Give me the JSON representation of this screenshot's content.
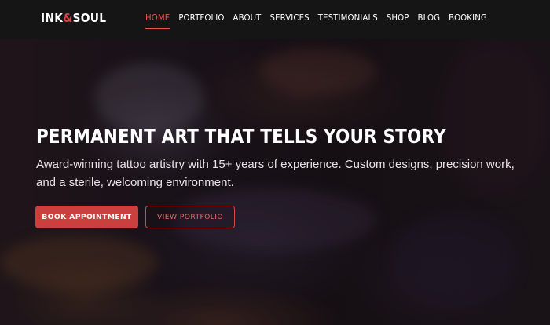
{
  "brand": {
    "name_part1": "INK",
    "ampersand": "&",
    "name_part2": "SOUL"
  },
  "nav": {
    "items": [
      {
        "label": "HOME",
        "active": true
      },
      {
        "label": "PORTFOLIO",
        "active": false
      },
      {
        "label": "ABOUT",
        "active": false
      },
      {
        "label": "SERVICES",
        "active": false
      },
      {
        "label": "TESTIMONIALS",
        "active": false
      },
      {
        "label": "SHOP",
        "active": false
      },
      {
        "label": "BLOG",
        "active": false
      },
      {
        "label": "BOOKING",
        "active": false
      }
    ]
  },
  "hero": {
    "title": "PERMANENT ART THAT TELLS YOUR STORY",
    "description": "Award-winning tattoo artistry with 15+ years of experience. Custom designs, precision work, and a sterile, welcoming environment.",
    "primary_button": "BOOK APPOINTMENT",
    "secondary_button": "VIEW PORTFOLIO"
  },
  "colors": {
    "accent": "#cc3f3f",
    "header_bg": "#151515",
    "nav_active": "#e0564f"
  }
}
